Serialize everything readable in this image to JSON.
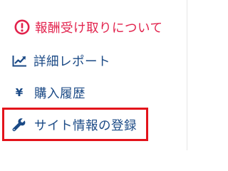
{
  "menu": {
    "items": [
      {
        "label": "報酬受け取りについて",
        "icon": "alert-circle-icon"
      },
      {
        "label": "詳細レポート",
        "icon": "line-chart-icon"
      },
      {
        "label": "購入履歴",
        "icon": "yen-icon",
        "glyph": "¥"
      },
      {
        "label": "サイト情報の登録",
        "icon": "wrench-icon"
      }
    ]
  },
  "colors": {
    "alert": "#e2224c",
    "nav_text": "#1b4a86",
    "highlight_border": "#e3131b"
  }
}
